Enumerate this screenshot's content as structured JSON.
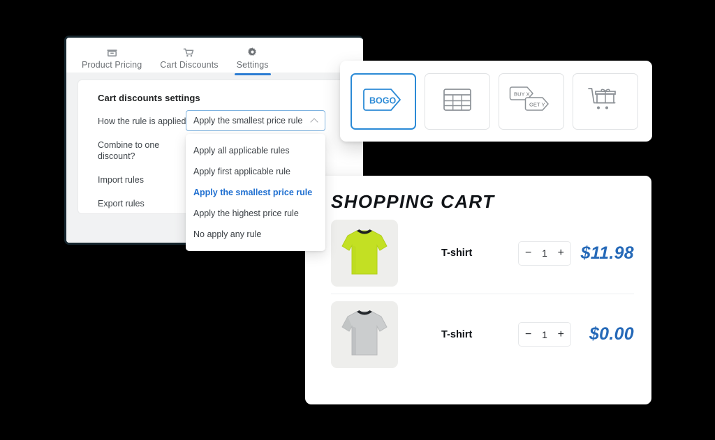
{
  "settings_window": {
    "tabs": [
      {
        "label": "Product Pricing",
        "icon": "box-icon",
        "active": false
      },
      {
        "label": "Cart Discounts",
        "icon": "cart-icon",
        "active": false
      },
      {
        "label": "Settings",
        "icon": "gear-icon",
        "active": true
      }
    ],
    "card_title": "Cart discounts settings",
    "rows": [
      {
        "label": "How the rule is applied"
      },
      {
        "label": "Combine to one discount?"
      },
      {
        "label": "Import rules"
      },
      {
        "label": "Export rules"
      }
    ],
    "select": {
      "value": "Apply the smallest price rule",
      "chevron": "chevron-up-icon",
      "options": [
        "Apply all applicable rules",
        "Apply first applicable rule",
        "Apply the smallest price rule",
        "Apply the highest price rule",
        "No apply any rule"
      ],
      "selected_index": 2
    }
  },
  "icon_panel": {
    "cards": [
      {
        "icon": "bogo-tag-icon",
        "label": "BOGO",
        "selected": true
      },
      {
        "icon": "table-grid-icon",
        "label": "",
        "selected": false
      },
      {
        "icon": "buy-x-get-y-tags-icon",
        "label": "BUY X",
        "label2": "GET Y",
        "selected": false
      },
      {
        "icon": "cart-gift-icon",
        "label": "",
        "selected": false
      }
    ]
  },
  "cart": {
    "title": "SHOPPING CART",
    "items": [
      {
        "name": "T-shirt",
        "thumb": "lime-tshirt-image",
        "quantity": "1",
        "price": "$11.98",
        "minus": "−",
        "plus": "+"
      },
      {
        "name": "T-shirt",
        "thumb": "gray-tshirt-image",
        "quantity": "1",
        "price": "$0.00",
        "minus": "−",
        "plus": "+"
      }
    ]
  },
  "colors": {
    "background": "#000000",
    "window_border": "#16262e",
    "accent_blue": "#2b7cd3",
    "link_blue": "#1f6fd0",
    "price_blue": "#2569b8",
    "panel_gray": "#f1f2f3",
    "thumb_gray": "#eeeeec",
    "icon_gray": "#8c9196",
    "shirt_lime": "#c3e023",
    "shirt_gray": "#c9cbcc"
  }
}
